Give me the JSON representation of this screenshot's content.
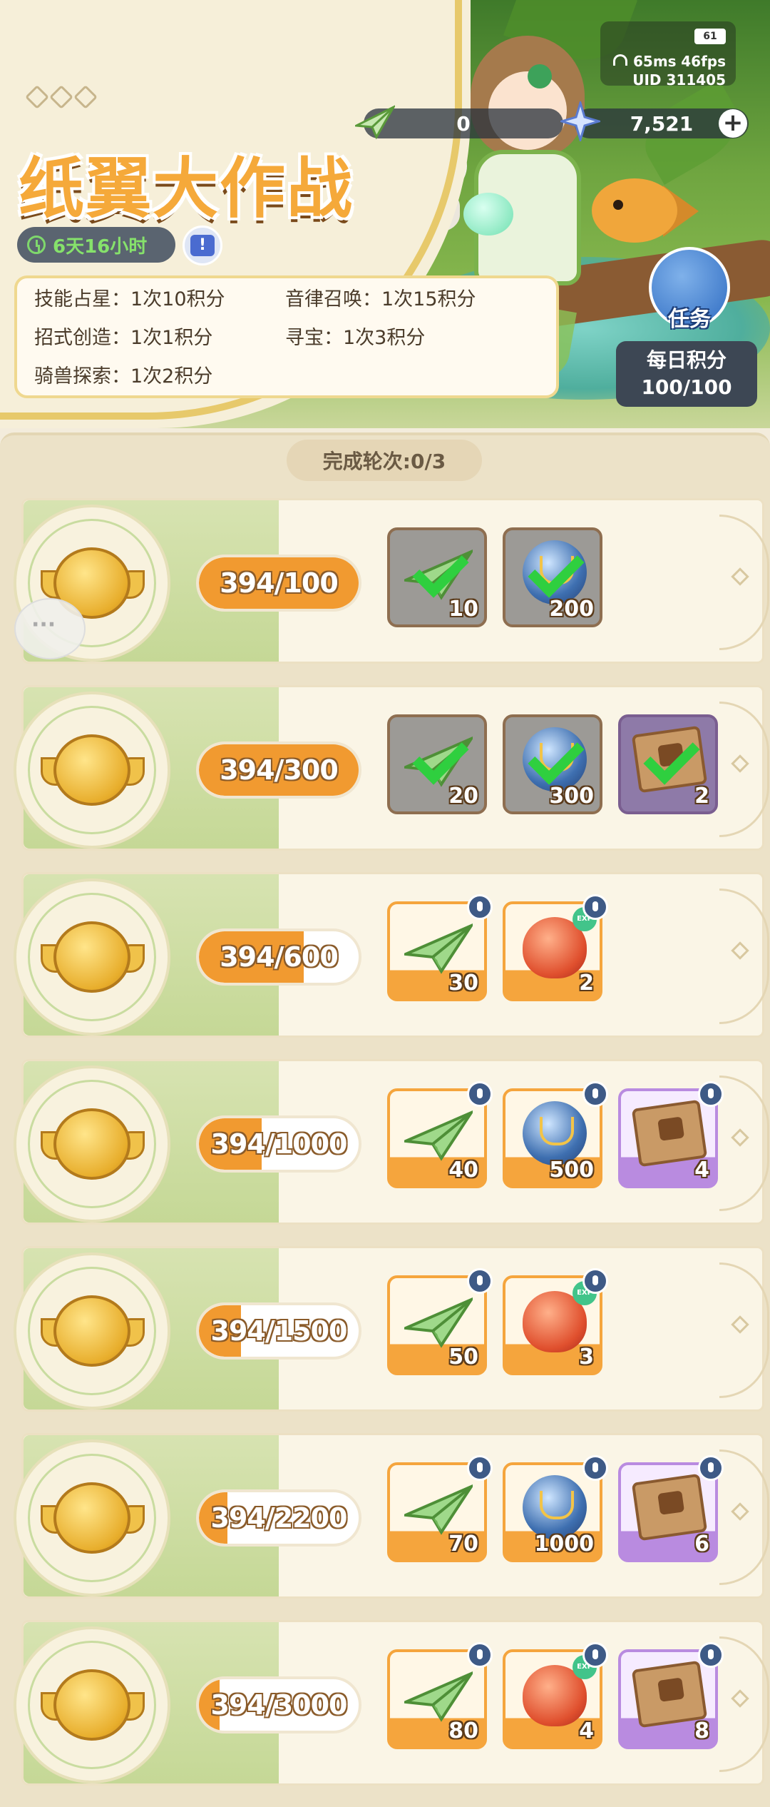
{
  "header": {
    "title": "纸翼大作战",
    "timer": "6天16小时",
    "info_label": "!",
    "rules": [
      {
        "name": "技能占星：",
        "value": "1次10积分"
      },
      {
        "name": "音律召唤：",
        "value": "1次15积分"
      },
      {
        "name": "招式创造：",
        "value": "1次1积分"
      },
      {
        "name": "寻宝：",
        "value": "1次3积分"
      },
      {
        "name": "骑兽探索：",
        "value": "1次2积分"
      }
    ],
    "currency_plane": "0",
    "currency_star": "7,521",
    "plus": "+",
    "task_label": "任务",
    "daily_label": "每日积分",
    "daily_value": "100/100"
  },
  "status": {
    "battery": "61",
    "ping": "65ms",
    "fps": "46fps",
    "uid": "UID 311405"
  },
  "rounds_label": "完成轮次:0/3",
  "rows": [
    {
      "progress": "394/100",
      "fill": 1.0,
      "items": [
        {
          "type": "plane",
          "qty": "10",
          "claimed": true,
          "style": "orange"
        },
        {
          "type": "orb",
          "qty": "200",
          "claimed": true,
          "style": "orange"
        }
      ]
    },
    {
      "progress": "394/300",
      "fill": 1.0,
      "items": [
        {
          "type": "plane",
          "qty": "20",
          "claimed": true,
          "style": "orange"
        },
        {
          "type": "orb",
          "qty": "300",
          "claimed": true,
          "style": "orange"
        },
        {
          "type": "book",
          "qty": "2",
          "claimed": true,
          "style": "purple"
        }
      ]
    },
    {
      "progress": "394/600",
      "fill": 0.657,
      "items": [
        {
          "type": "plane",
          "qty": "30",
          "claimed": false,
          "style": "orange"
        },
        {
          "type": "slime",
          "qty": "2",
          "claimed": false,
          "style": "orange"
        }
      ]
    },
    {
      "progress": "394/1000",
      "fill": 0.394,
      "items": [
        {
          "type": "plane",
          "qty": "40",
          "claimed": false,
          "style": "orange"
        },
        {
          "type": "orb",
          "qty": "500",
          "claimed": false,
          "style": "orange"
        },
        {
          "type": "book",
          "qty": "4",
          "claimed": false,
          "style": "purple"
        }
      ]
    },
    {
      "progress": "394/1500",
      "fill": 0.263,
      "items": [
        {
          "type": "plane",
          "qty": "50",
          "claimed": false,
          "style": "orange"
        },
        {
          "type": "slime",
          "qty": "3",
          "claimed": false,
          "style": "orange"
        }
      ]
    },
    {
      "progress": "394/2200",
      "fill": 0.179,
      "items": [
        {
          "type": "plane",
          "qty": "70",
          "claimed": false,
          "style": "orange"
        },
        {
          "type": "orb",
          "qty": "1000",
          "claimed": false,
          "style": "orange"
        },
        {
          "type": "book",
          "qty": "6",
          "claimed": false,
          "style": "purple"
        }
      ]
    },
    {
      "progress": "394/3000",
      "fill": 0.131,
      "items": [
        {
          "type": "plane",
          "qty": "80",
          "claimed": false,
          "style": "orange"
        },
        {
          "type": "slime",
          "qty": "4",
          "claimed": false,
          "style": "orange"
        },
        {
          "type": "book",
          "qty": "8",
          "claimed": false,
          "style": "purple"
        }
      ]
    }
  ],
  "exp_badge": "EXP"
}
